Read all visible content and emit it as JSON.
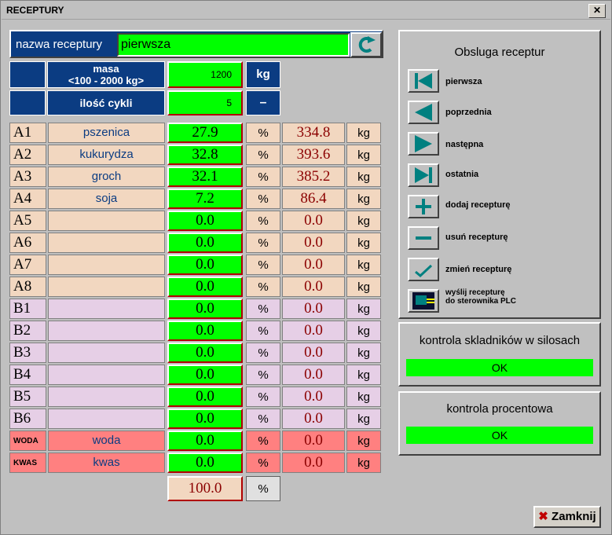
{
  "window": {
    "title": "RECEPTURY",
    "close": "✕"
  },
  "recipe": {
    "label": "nazwa receptury",
    "value": "pierwsza"
  },
  "masa": {
    "label_line1": "masa",
    "label_line2": "<100 - 2000 kg>",
    "value": "1200",
    "unit": "kg"
  },
  "cykle": {
    "label": "ilość cykli",
    "value": "5",
    "unit": "–"
  },
  "rows": [
    {
      "code": "A1",
      "name": "pszenica",
      "pct": "27.9",
      "pct_unit": "%",
      "kg": "334.8",
      "kg_unit": "kg"
    },
    {
      "code": "A2",
      "name": "kukurydza",
      "pct": "32.8",
      "pct_unit": "%",
      "kg": "393.6",
      "kg_unit": "kg"
    },
    {
      "code": "A3",
      "name": "groch",
      "pct": "32.1",
      "pct_unit": "%",
      "kg": "385.2",
      "kg_unit": "kg"
    },
    {
      "code": "A4",
      "name": "soja",
      "pct": "7.2",
      "pct_unit": "%",
      "kg": "86.4",
      "kg_unit": "kg"
    },
    {
      "code": "A5",
      "name": "",
      "pct": "0.0",
      "pct_unit": "%",
      "kg": "0.0",
      "kg_unit": "kg"
    },
    {
      "code": "A6",
      "name": "",
      "pct": "0.0",
      "pct_unit": "%",
      "kg": "0.0",
      "kg_unit": "kg"
    },
    {
      "code": "A7",
      "name": "",
      "pct": "0.0",
      "pct_unit": "%",
      "kg": "0.0",
      "kg_unit": "kg"
    },
    {
      "code": "A8",
      "name": "",
      "pct": "0.0",
      "pct_unit": "%",
      "kg": "0.0",
      "kg_unit": "kg"
    },
    {
      "code": "B1",
      "name": "",
      "pct": "0.0",
      "pct_unit": "%",
      "kg": "0.0",
      "kg_unit": "kg"
    },
    {
      "code": "B2",
      "name": "",
      "pct": "0.0",
      "pct_unit": "%",
      "kg": "0.0",
      "kg_unit": "kg"
    },
    {
      "code": "B3",
      "name": "",
      "pct": "0.0",
      "pct_unit": "%",
      "kg": "0.0",
      "kg_unit": "kg"
    },
    {
      "code": "B4",
      "name": "",
      "pct": "0.0",
      "pct_unit": "%",
      "kg": "0.0",
      "kg_unit": "kg"
    },
    {
      "code": "B5",
      "name": "",
      "pct": "0.0",
      "pct_unit": "%",
      "kg": "0.0",
      "kg_unit": "kg"
    },
    {
      "code": "B6",
      "name": "",
      "pct": "0.0",
      "pct_unit": "%",
      "kg": "0.0",
      "kg_unit": "kg"
    },
    {
      "code": "WODA",
      "name": "woda",
      "pct": "0.0",
      "pct_unit": "%",
      "kg": "0.0",
      "kg_unit": "kg"
    },
    {
      "code": "KWAS",
      "name": "kwas",
      "pct": "0.0",
      "pct_unit": "%",
      "kg": "0.0",
      "kg_unit": "kg"
    }
  ],
  "total": {
    "value": "100.0",
    "unit": "%"
  },
  "obsluga": {
    "title": "Obsluga receptur",
    "first": "pierwsza",
    "prev": "poprzednia",
    "next": "następna",
    "last": "ostatnia",
    "add": "dodaj recepturę",
    "delete": "usuń recepturę",
    "edit": "zmień recepturę",
    "send_line1": "wyślij recepturę",
    "send_line2": "do sterownika PLC"
  },
  "kontrola_silosy": {
    "title": "kontrola skladników w silosach",
    "status": "OK"
  },
  "kontrola_proc": {
    "title": "kontrola procentowa",
    "status": "OK"
  },
  "close_button": {
    "label": "Zamknij"
  },
  "colors": {
    "navy": "#0b3c82",
    "green": "#00ff00",
    "tan": "#f2d7c0",
    "lavender": "#e6cfe6",
    "salmon": "#ff8080",
    "dark_red": "#8b0000",
    "teal_icon": "#008080"
  }
}
